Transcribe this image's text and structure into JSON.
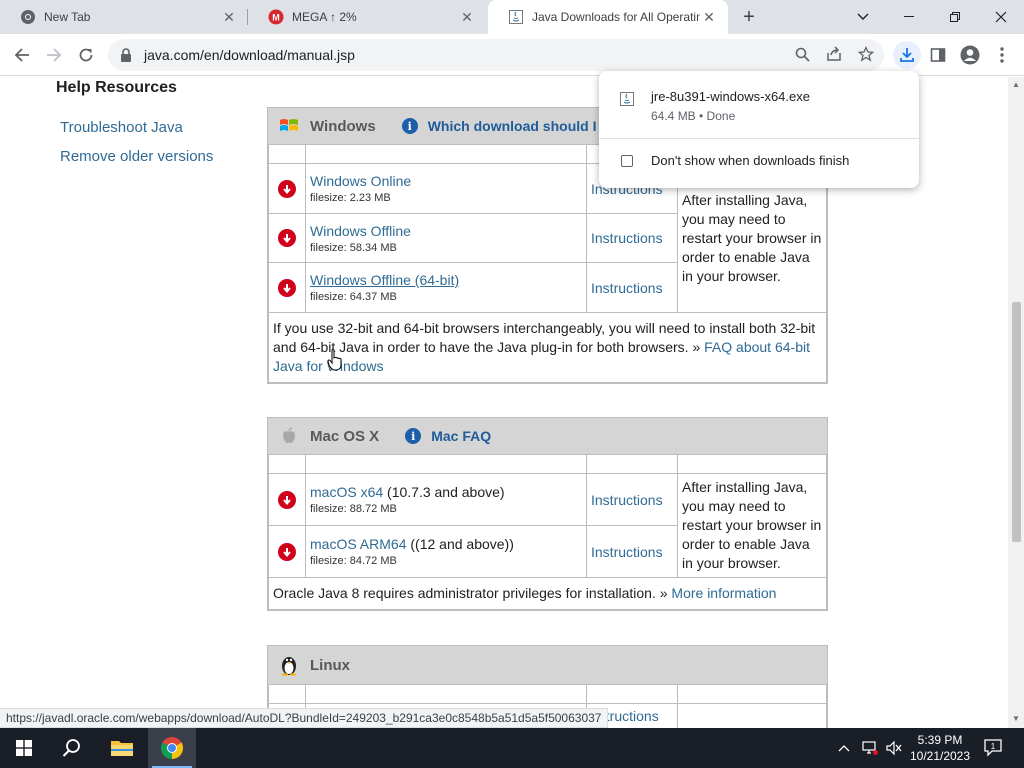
{
  "browser": {
    "tabs": [
      {
        "title": "New Tab",
        "icon": "chrome-icon",
        "active": false
      },
      {
        "title": "MEGA ↑ 2%",
        "icon": "mega-icon",
        "active": false
      },
      {
        "title": "Java Downloads for All Operatin",
        "icon": "java-icon",
        "active": true
      }
    ],
    "url": "java.com/en/download/manual.jsp",
    "status_url": "https://javadl.oracle.com/webapps/download/AutoDL?BundleId=249203_b291ca3e0c8548b5a51d5a5f50063037"
  },
  "download_bubble": {
    "file_name": "jre-8u391-windows-x64.exe",
    "file_status": "64.4 MB • Done",
    "checkbox_label": "Don't show when downloads finish"
  },
  "sidebar": {
    "title": "Help Resources",
    "links": [
      "Troubleshoot Java",
      "Remove older versions"
    ]
  },
  "windows": {
    "name": "Windows",
    "faq_link": "Which download should I",
    "rows": [
      {
        "link": "Windows Online",
        "extra": "",
        "filesize": "filesize: 2.23 MB",
        "instructions": "Instructions"
      },
      {
        "link": "Windows Offline",
        "extra": "",
        "filesize": "filesize: 58.34 MB",
        "instructions": "Instructions"
      },
      {
        "link": "Windows Offline (64-bit)",
        "extra": "",
        "filesize": "filesize: 64.37 MB",
        "instructions": "Instructions"
      }
    ],
    "note": "After installing Java, you may need to restart your browser in order to enable Java in your browser.",
    "footer_text": "If you use 32-bit and 64-bit browsers interchangeably, you will need to install both 32-bit and 64-bit Java in order to have the Java plug-in for both browsers. » ",
    "footer_link": "FAQ about 64-bit Java for Windows"
  },
  "mac": {
    "name": "Mac OS X",
    "faq_link": "Mac FAQ",
    "rows": [
      {
        "link": "macOS x64",
        "extra": " (10.7.3 and above)",
        "filesize": "filesize: 88.72 MB",
        "instructions": "Instructions"
      },
      {
        "link": "macOS ARM64",
        "extra": " ((12 and above))",
        "filesize": "filesize: 84.72 MB",
        "instructions": "Instructions"
      }
    ],
    "note": "After installing Java, you may need to restart your browser in order to enable Java in your browser.",
    "footer_text": "Oracle Java 8 requires administrator privileges for installation. » ",
    "footer_link": "More information"
  },
  "linux": {
    "name": "Linux",
    "partial_instructions": "nstructions"
  },
  "taskbar": {
    "time": "5:39 PM",
    "date": "10/21/2023",
    "notification_count": "1"
  },
  "colors": {
    "link": "#2f6b94",
    "header_bg": "#d5d5d5",
    "download_red": "#d0021b",
    "info_blue": "#1f5faa"
  }
}
